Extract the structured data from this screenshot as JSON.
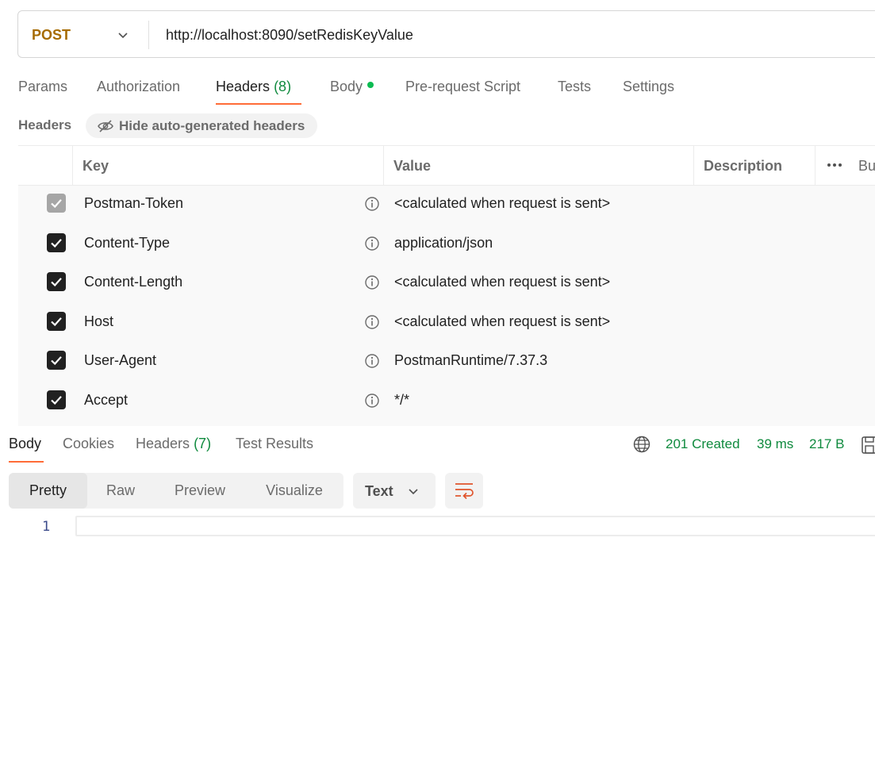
{
  "request": {
    "method": "POST",
    "url": "http://localhost:8090/setRedisKeyValue"
  },
  "request_tabs": [
    {
      "label": "Params"
    },
    {
      "label": "Authorization"
    },
    {
      "label": "Headers",
      "count": "(8)",
      "active": true
    },
    {
      "label": "Body",
      "has_dot": true
    },
    {
      "label": "Pre-request Script"
    },
    {
      "label": "Tests"
    },
    {
      "label": "Settings"
    }
  ],
  "headers_section": {
    "title": "Headers",
    "toggle_label": "Hide auto-generated headers"
  },
  "table": {
    "columns": {
      "key": "Key",
      "value": "Value",
      "description": "Description",
      "bulk": "Bu"
    },
    "rows": [
      {
        "key": "Postman-Token",
        "value": "<calculated when request is sent>",
        "checked": true,
        "disabled": true
      },
      {
        "key": "Content-Type",
        "value": "application/json",
        "checked": true
      },
      {
        "key": "Content-Length",
        "value": "<calculated when request is sent>",
        "checked": true
      },
      {
        "key": "Host",
        "value": "<calculated when request is sent>",
        "checked": true
      },
      {
        "key": "User-Agent",
        "value": "PostmanRuntime/7.37.3",
        "checked": true
      },
      {
        "key": "Accept",
        "value": "*/*",
        "checked": true
      }
    ]
  },
  "response": {
    "tabs": [
      {
        "label": "Body",
        "active": true
      },
      {
        "label": "Cookies"
      },
      {
        "label": "Headers",
        "count": "(7)"
      },
      {
        "label": "Test Results"
      }
    ],
    "status": "201 Created",
    "time": "39 ms",
    "size": "217 B",
    "view_modes": [
      "Pretty",
      "Raw",
      "Preview",
      "Visualize"
    ],
    "active_view": "Pretty",
    "format": "Text",
    "line_number": "1"
  },
  "colors": {
    "accent": "#ff6c37",
    "success": "#0f8a3e",
    "method": "#a66b00"
  }
}
